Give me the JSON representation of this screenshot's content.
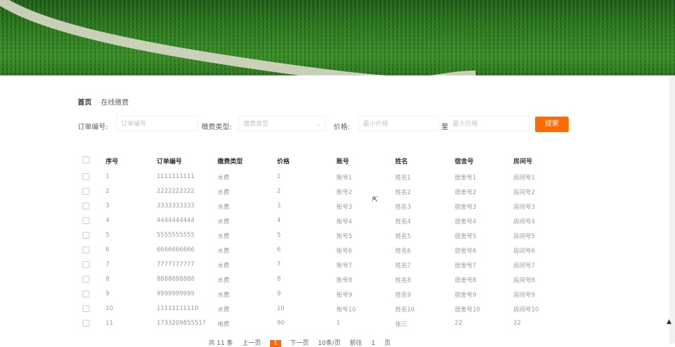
{
  "breadcrumb": {
    "home": "首页",
    "current": "在线缴费"
  },
  "search": {
    "order_label": "订单编号:",
    "order_placeholder": "订单编号",
    "type_label": "缴费类型:",
    "type_placeholder": "缴费类型",
    "price_label": "价格:",
    "min_placeholder": "最小价格",
    "to_label": "至",
    "max_placeholder": "最大价格",
    "search_button": "搜索"
  },
  "table": {
    "headers": [
      "序号",
      "订单编号",
      "缴费类型",
      "价格",
      "账号",
      "姓名",
      "宿舍号",
      "房间号"
    ],
    "rows": [
      [
        "1",
        "1111111111",
        "水费",
        "1",
        "账号1",
        "姓名1",
        "宿舍号1",
        "房间号1"
      ],
      [
        "2",
        "2222222222",
        "水费",
        "2",
        "账号2",
        "姓名2",
        "宿舍号2",
        "房间号2"
      ],
      [
        "3",
        "3333333333",
        "水费",
        "3",
        "账号3",
        "姓名3",
        "宿舍号3",
        "房间号3"
      ],
      [
        "4",
        "4444444444",
        "水费",
        "4",
        "账号4",
        "姓名4",
        "宿舍号4",
        "房间号4"
      ],
      [
        "5",
        "5555555555",
        "水费",
        "5",
        "账号5",
        "姓名5",
        "宿舍号5",
        "房间号5"
      ],
      [
        "6",
        "6666666666",
        "水费",
        "6",
        "账号6",
        "姓名6",
        "宿舍号6",
        "房间号6"
      ],
      [
        "7",
        "7777777777",
        "水费",
        "7",
        "账号7",
        "姓名7",
        "宿舍号7",
        "房间号7"
      ],
      [
        "8",
        "8888888888",
        "水费",
        "8",
        "账号8",
        "姓名8",
        "宿舍号8",
        "房间号8"
      ],
      [
        "9",
        "9999999999",
        "水费",
        "9",
        "账号9",
        "姓名9",
        "宿舍号9",
        "房间号9"
      ],
      [
        "10",
        "11111111110",
        "水费",
        "10",
        "账号10",
        "姓名10",
        "宿舍号10",
        "房间号10"
      ],
      [
        "11",
        "1733209855517",
        "电费",
        "90",
        "1",
        "张三",
        "22",
        "22"
      ]
    ]
  },
  "pager": {
    "total": "共 11 条",
    "prev": "上一页",
    "page": "1",
    "next": "下一页",
    "size": "10条/页",
    "goto": "前往",
    "goto_page": "1",
    "page_unit": "页"
  },
  "colors": {
    "accent": "#ff6a00"
  }
}
